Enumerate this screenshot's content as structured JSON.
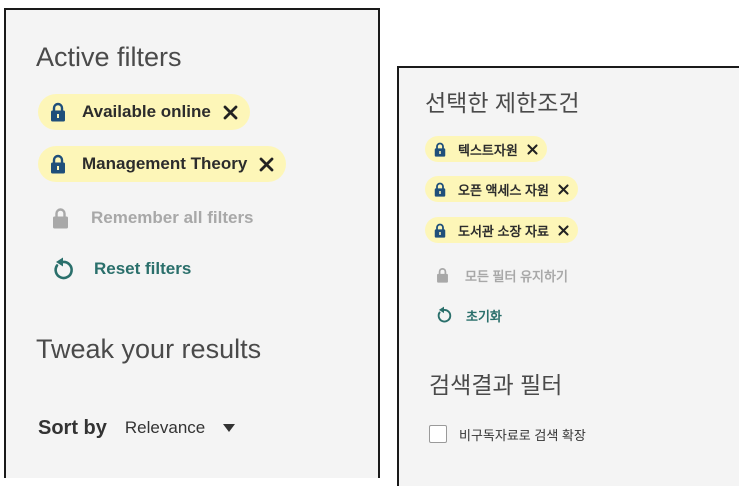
{
  "left": {
    "active_title": "Active filters",
    "chips": [
      {
        "label": "Available online"
      },
      {
        "label": "Management Theory"
      }
    ],
    "remember_label": "Remember all filters",
    "reset_label": "Reset filters",
    "tweak_title": "Tweak your results",
    "sort_label": "Sort by",
    "sort_value": "Relevance"
  },
  "right": {
    "active_title": "선택한 제한조건",
    "chips": [
      {
        "label": "텍스트자원"
      },
      {
        "label": "오픈 액세스 자원"
      },
      {
        "label": "도서관 소장 자료"
      }
    ],
    "remember_label": "모든 필터 유지하기",
    "reset_label": "초기화",
    "results_title": "검색결과 필터",
    "checkbox_label": "비구독자료로 검색 확장"
  },
  "colors": {
    "chip_bg": "#fdf6b8",
    "lock_active": "#1f4f7a",
    "muted": "#a8a8a8",
    "teal": "#2a6f6b"
  },
  "icons": {
    "lock": "lock-icon",
    "close": "close-icon",
    "reset": "reset-icon",
    "dropdown": "caret-down-icon"
  }
}
